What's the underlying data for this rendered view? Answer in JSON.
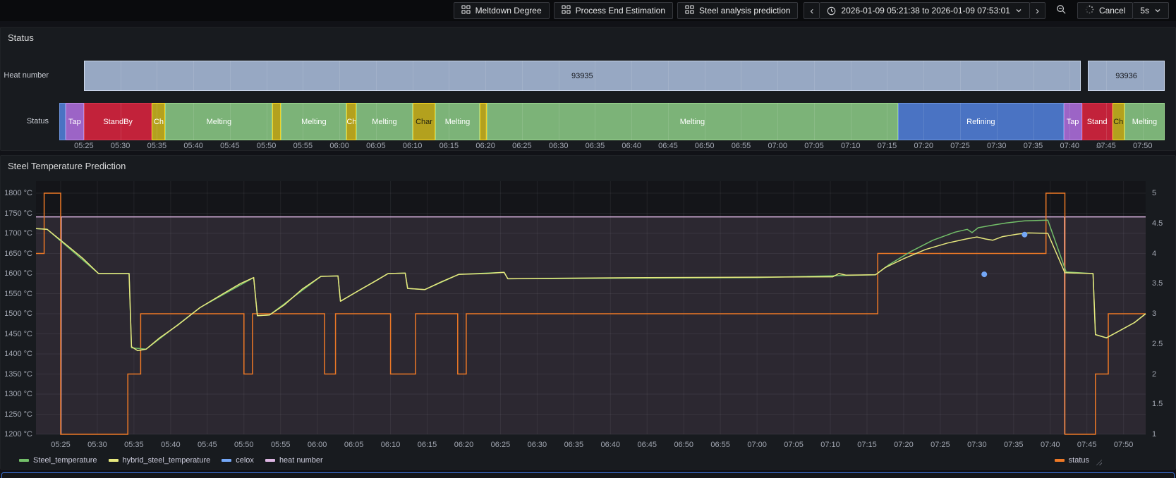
{
  "toolbar": {
    "dashboard_links": [
      {
        "label": "Meltdown Degree"
      },
      {
        "label": "Process End Estimation"
      },
      {
        "label": "Steel analysis prediction"
      }
    ],
    "time_range": "2026-01-09 05:21:38 to 2026-01-09 07:53:01",
    "cancel_label": "Cancel",
    "refresh_interval": "5s"
  },
  "time_axis": {
    "start": "05:21:38",
    "end": "07:53:01",
    "ticks": [
      "05:25",
      "05:30",
      "05:35",
      "05:40",
      "05:45",
      "05:50",
      "05:55",
      "06:00",
      "06:05",
      "06:10",
      "06:15",
      "06:20",
      "06:25",
      "06:30",
      "06:35",
      "06:40",
      "06:45",
      "06:50",
      "06:55",
      "07:00",
      "07:05",
      "07:10",
      "07:15",
      "07:20",
      "07:25",
      "07:30",
      "07:35",
      "07:40",
      "07:45",
      "07:50"
    ]
  },
  "status_panel": {
    "title": "Status"
  },
  "temperature_panel": {
    "title": "Steel Temperature Prediction",
    "y_left_ticks": [
      "1800 °C",
      "1750 °C",
      "1700 °C",
      "1650 °C",
      "1600 °C",
      "1550 °C",
      "1500 °C",
      "1450 °C",
      "1400 °C",
      "1350 °C",
      "1300 °C",
      "1250 °C",
      "1200 °C"
    ],
    "y_right_ticks": [
      "5",
      "4.5",
      "4",
      "3.5",
      "3",
      "2.5",
      "2",
      "1.5",
      "1"
    ]
  },
  "colors": {
    "page_bg": "#111217",
    "panel_bg": "#181b1f",
    "plot_bg": "#141519",
    "grid": "rgba(204,210,222,0.08)",
    "heat_bar": {
      "fill": "#97a8c3",
      "border": "#cdd9ec",
      "text": "#15171c"
    },
    "heat_area_fill": "rgba(218,182,227,0.12)",
    "state_label_dark": "#23240f",
    "states": {
      "Refining": {
        "fill": "#4a73c3",
        "border": "#6b93dd"
      },
      "Tap": {
        "fill": "#9c64c6",
        "border": "#bb8ae0"
      },
      "StandBy": {
        "fill": "#c2223a",
        "border": "#d5354c"
      },
      "Charging": {
        "fill": "#b3a11e",
        "border": "#f3d323"
      },
      "Melting": {
        "fill": "#7cb378",
        "border": "#99d48d"
      }
    }
  },
  "chart_data": [
    {
      "type": "table",
      "title": "Status",
      "panel_kind": "state-timeline",
      "heat_row": {
        "label": "Heat number",
        "segments": [
          {
            "value": "93935",
            "start": "05:25:00",
            "end": "07:41:30"
          },
          {
            "value": "93936",
            "start": "07:42:30",
            "end": "07:53:01"
          }
        ]
      },
      "status_row": {
        "label": "Status",
        "segments": [
          {
            "state": "Refining",
            "label": "",
            "start": "05:21:38",
            "end": "05:22:30"
          },
          {
            "state": "Tap",
            "label": "Tap",
            "start": "05:22:30",
            "end": "05:25:00"
          },
          {
            "state": "StandBy",
            "label": "StandBy",
            "start": "05:25:00",
            "end": "05:34:20"
          },
          {
            "state": "Charging",
            "label": "Ch",
            "start": "05:34:20",
            "end": "05:36:10"
          },
          {
            "state": "Melting",
            "label": "Melting",
            "start": "05:36:10",
            "end": "05:50:50"
          },
          {
            "state": "Charging",
            "label": "",
            "start": "05:50:50",
            "end": "05:52:00"
          },
          {
            "state": "Melting",
            "label": "Melting",
            "start": "05:52:00",
            "end": "06:01:00"
          },
          {
            "state": "Charging",
            "label": "Ch",
            "start": "06:01:00",
            "end": "06:02:20"
          },
          {
            "state": "Melting",
            "label": "Melting",
            "start": "06:02:20",
            "end": "06:10:00"
          },
          {
            "state": "Charging",
            "label": "Char",
            "start": "06:10:00",
            "end": "06:13:10",
            "dark_label": true
          },
          {
            "state": "Melting",
            "label": "Melting",
            "start": "06:13:10",
            "end": "06:19:10"
          },
          {
            "state": "Charging",
            "label": "",
            "start": "06:19:10",
            "end": "06:20:10"
          },
          {
            "state": "Melting",
            "label": "Melting",
            "start": "06:20:10",
            "end": "07:16:30"
          },
          {
            "state": "Refining",
            "label": "Refining",
            "start": "07:16:30",
            "end": "07:39:10"
          },
          {
            "state": "Tap",
            "label": "Tap",
            "start": "07:39:10",
            "end": "07:41:40"
          },
          {
            "state": "StandBy",
            "label": "Stand",
            "start": "07:41:40",
            "end": "07:45:50"
          },
          {
            "state": "Charging",
            "label": "Ch",
            "start": "07:45:50",
            "end": "07:47:30",
            "dark_label": true
          },
          {
            "state": "Melting",
            "label": "Melting",
            "start": "07:47:30",
            "end": "07:53:01"
          }
        ]
      }
    },
    {
      "type": "line",
      "title": "Steel Temperature Prediction",
      "x_range": [
        "05:21:38",
        "07:53:01"
      ],
      "ylim_left": [
        1200,
        1800
      ],
      "ylabel_left_unit": "°C",
      "ylim_right": [
        1,
        5
      ],
      "legend_position": "bottom",
      "series": [
        {
          "name": "Steel_temperature",
          "color": "#73bf69",
          "axis": "left",
          "legend": "left",
          "points": [
            [
              "05:21:38",
              1712
            ],
            [
              "05:23:10",
              1710
            ],
            [
              "05:30:10",
              1600
            ],
            [
              "05:34:20",
              1600
            ],
            [
              "05:34:40",
              1415
            ],
            [
              "05:36:40",
              1412
            ],
            [
              "05:44:00",
              1515
            ],
            [
              "05:51:20",
              1590
            ],
            [
              "05:51:50",
              1495
            ],
            [
              "05:53:30",
              1497
            ],
            [
              "06:00:30",
              1593
            ],
            [
              "06:02:50",
              1594
            ],
            [
              "06:03:10",
              1531
            ],
            [
              "06:09:40",
              1600
            ],
            [
              "06:12:00",
              1601
            ],
            [
              "06:12:20",
              1563
            ],
            [
              "06:14:40",
              1560
            ],
            [
              "06:19:20",
              1598
            ],
            [
              "06:25:30",
              1603
            ],
            [
              "06:26:00",
              1587
            ],
            [
              "07:00:00",
              1590
            ],
            [
              "07:16:10",
              1597
            ],
            [
              "07:18:00",
              1622
            ],
            [
              "07:21:00",
              1655
            ],
            [
              "07:24:00",
              1683
            ],
            [
              "07:27:00",
              1703
            ],
            [
              "07:28:40",
              1710
            ],
            [
              "07:29:20",
              1702
            ],
            [
              "07:30:10",
              1714
            ],
            [
              "07:32:00",
              1720
            ],
            [
              "07:34:00",
              1726
            ],
            [
              "07:36:30",
              1731
            ],
            [
              "07:39:40",
              1733
            ],
            [
              "07:42:10",
              1604
            ],
            [
              "07:45:50",
              1600
            ],
            [
              "07:46:10",
              1448
            ],
            [
              "07:47:40",
              1440
            ],
            [
              "07:49:30",
              1458
            ],
            [
              "07:51:30",
              1478
            ],
            [
              "07:53:01",
              1500
            ]
          ]
        },
        {
          "name": "hybrid_steel_temperature",
          "color": "#e7e87e",
          "axis": "left",
          "legend": "left",
          "points": [
            [
              "05:21:38",
              1712
            ],
            [
              "05:23:10",
              1710
            ],
            [
              "05:26:00",
              1668
            ],
            [
              "05:28:00",
              1638
            ],
            [
              "05:30:10",
              1600
            ],
            [
              "05:34:20",
              1600
            ],
            [
              "05:34:40",
              1418
            ],
            [
              "05:35:30",
              1408
            ],
            [
              "05:36:40",
              1412
            ],
            [
              "05:38:30",
              1440
            ],
            [
              "05:41:00",
              1472
            ],
            [
              "05:44:00",
              1515
            ],
            [
              "05:47:00",
              1548
            ],
            [
              "05:49:30",
              1575
            ],
            [
              "05:51:20",
              1590
            ],
            [
              "05:51:50",
              1495
            ],
            [
              "05:53:30",
              1497
            ],
            [
              "05:55:30",
              1522
            ],
            [
              "05:58:00",
              1562
            ],
            [
              "06:00:30",
              1593
            ],
            [
              "06:02:50",
              1594
            ],
            [
              "06:03:10",
              1531
            ],
            [
              "06:05:30",
              1556
            ],
            [
              "06:08:00",
              1582
            ],
            [
              "06:09:40",
              1600
            ],
            [
              "06:12:00",
              1601
            ],
            [
              "06:12:20",
              1563
            ],
            [
              "06:14:40",
              1560
            ],
            [
              "06:17:00",
              1580
            ],
            [
              "06:19:20",
              1598
            ],
            [
              "06:23:00",
              1600
            ],
            [
              "06:25:30",
              1603
            ],
            [
              "06:26:00",
              1587
            ],
            [
              "06:32:00",
              1588
            ],
            [
              "06:45:00",
              1590
            ],
            [
              "07:00:00",
              1591
            ],
            [
              "07:10:20",
              1592
            ],
            [
              "07:11:10",
              1600
            ],
            [
              "07:12:10",
              1596
            ],
            [
              "07:16:10",
              1597
            ],
            [
              "07:17:30",
              1615
            ],
            [
              "07:20:00",
              1637
            ],
            [
              "07:23:00",
              1660
            ],
            [
              "07:26:00",
              1676
            ],
            [
              "07:28:30",
              1686
            ],
            [
              "07:30:00",
              1691
            ],
            [
              "07:31:10",
              1686
            ],
            [
              "07:32:10",
              1683
            ],
            [
              "07:33:30",
              1692
            ],
            [
              "07:35:30",
              1698
            ],
            [
              "07:37:00",
              1701
            ],
            [
              "07:39:40",
              1700
            ],
            [
              "07:42:00",
              1602
            ],
            [
              "07:45:50",
              1600
            ],
            [
              "07:46:10",
              1448
            ],
            [
              "07:47:40",
              1440
            ],
            [
              "07:49:30",
              1458
            ],
            [
              "07:51:30",
              1478
            ],
            [
              "07:53:01",
              1500
            ]
          ]
        },
        {
          "name": "celox",
          "color": "#74a7f7",
          "axis": "left",
          "legend": "left",
          "style": "points",
          "points": [
            [
              "07:31:00",
              1598
            ],
            [
              "07:36:30",
              1697
            ]
          ]
        },
        {
          "name": "heat number",
          "color": "#ddb6e3",
          "axis": "hidden",
          "legend": "left",
          "fill": true,
          "points": [
            [
              "05:21:38",
              1741
            ],
            [
              "05:25:01",
              1741
            ],
            [
              "05:25:03",
              1200
            ],
            [
              "05:25:05",
              1741
            ],
            [
              "07:41:56",
              1741
            ],
            [
              "07:41:58",
              1200
            ],
            [
              "07:42:00",
              1741
            ],
            [
              "07:53:01",
              1741
            ]
          ]
        },
        {
          "name": "status",
          "color": "#ee7926",
          "axis": "right",
          "legend": "right",
          "step": true,
          "points": [
            [
              "05:21:38",
              4
            ],
            [
              "05:22:45",
              5
            ],
            [
              "05:25:00",
              1
            ],
            [
              "05:34:10",
              2
            ],
            [
              "05:35:55",
              3
            ],
            [
              "05:50:00",
              2
            ],
            [
              "05:51:10",
              3
            ],
            [
              "06:01:00",
              2
            ],
            [
              "06:02:30",
              3
            ],
            [
              "06:10:00",
              2
            ],
            [
              "06:13:25",
              3
            ],
            [
              "06:19:10",
              2
            ],
            [
              "06:20:20",
              3
            ],
            [
              "07:16:28",
              4
            ],
            [
              "07:39:25",
              5
            ],
            [
              "07:42:00",
              1
            ],
            [
              "07:46:10",
              2
            ],
            [
              "07:47:55",
              3
            ],
            [
              "07:53:01",
              3
            ]
          ]
        }
      ]
    }
  ]
}
